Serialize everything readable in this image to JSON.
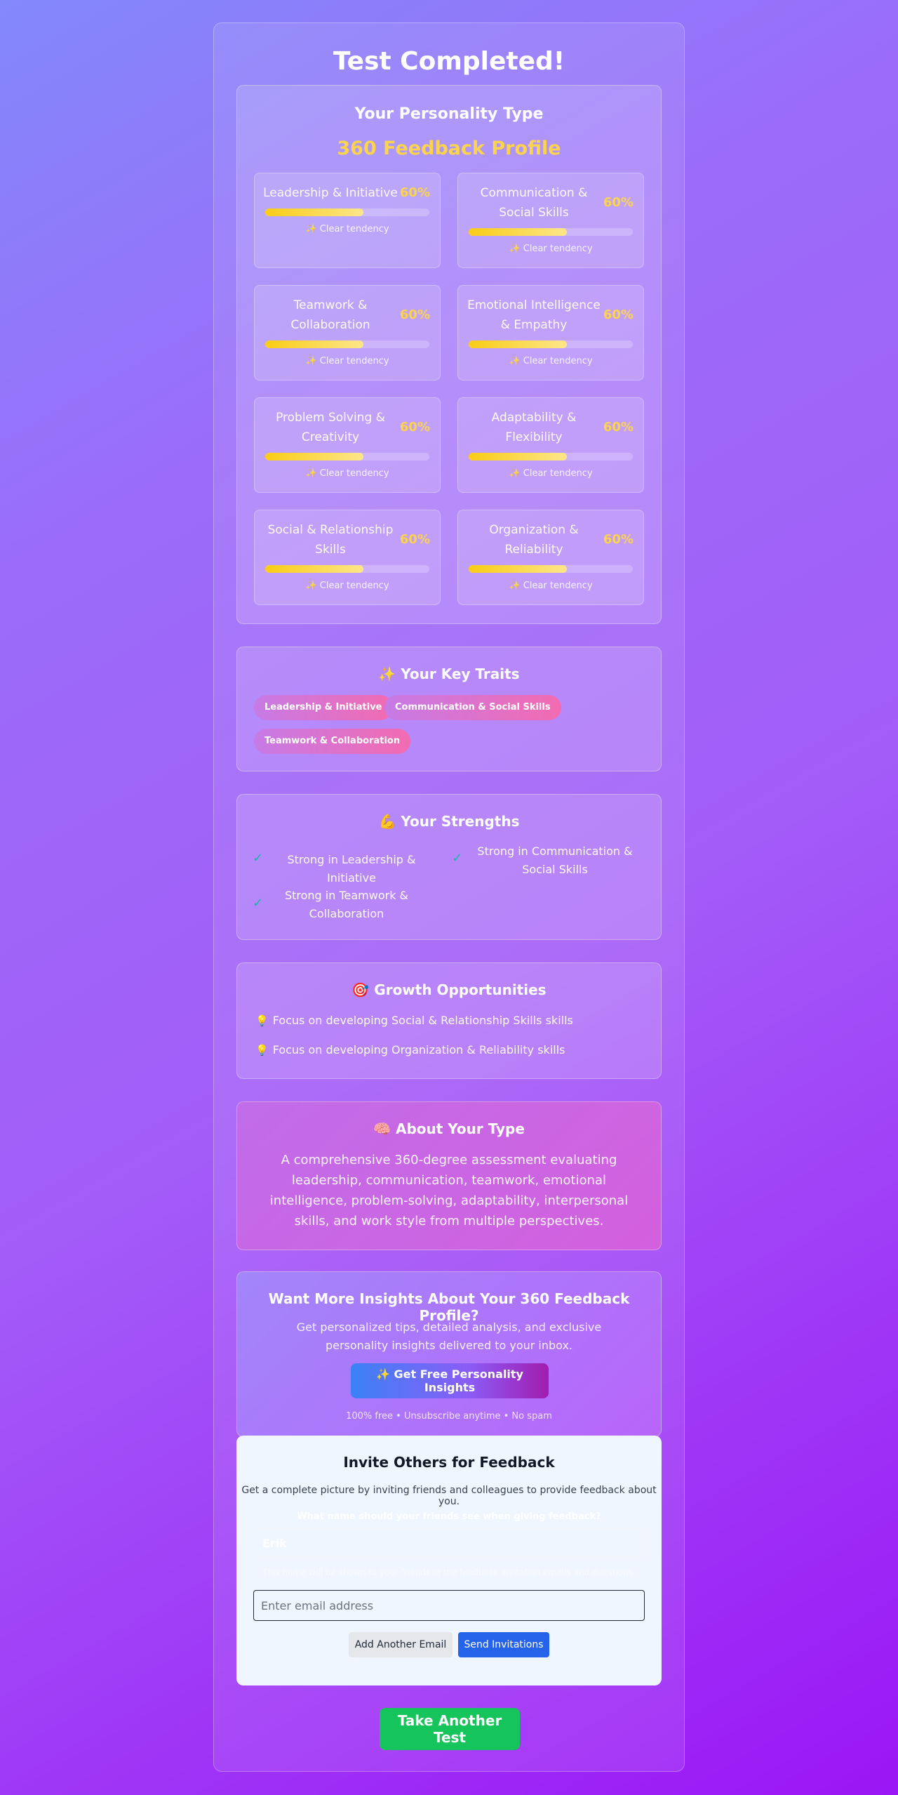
{
  "title": "Test Completed!",
  "personality": {
    "heading": "Your Personality Type",
    "type_name": "360 Feedback Profile",
    "dimensions": [
      {
        "name": "Leadership & Initiative",
        "percent_label": "60%",
        "percent": 60,
        "tendency": "✨ Clear tendency"
      },
      {
        "name": "Communication & Social Skills",
        "percent_label": "60%",
        "percent": 60,
        "tendency": "✨ Clear tendency"
      },
      {
        "name": "Teamwork & Collaboration",
        "percent_label": "60%",
        "percent": 60,
        "tendency": "✨ Clear tendency"
      },
      {
        "name": "Emotional Intelligence & Empathy",
        "percent_label": "60%",
        "percent": 60,
        "tendency": "✨ Clear tendency"
      },
      {
        "name": "Problem Solving & Creativity",
        "percent_label": "60%",
        "percent": 60,
        "tendency": "✨ Clear tendency"
      },
      {
        "name": "Adaptability & Flexibility",
        "percent_label": "60%",
        "percent": 60,
        "tendency": "✨ Clear tendency"
      },
      {
        "name": "Social & Relationship Skills",
        "percent_label": "60%",
        "percent": 60,
        "tendency": "✨ Clear tendency"
      },
      {
        "name": "Organization & Reliability",
        "percent_label": "60%",
        "percent": 60,
        "tendency": "✨ Clear tendency"
      }
    ]
  },
  "traits": {
    "heading": "✨ Your Key Traits",
    "items": [
      "Leadership & Initiative",
      "Communication & Social Skills",
      "Teamwork & Collaboration"
    ]
  },
  "strengths": {
    "heading": "💪 Your Strengths",
    "check": "✓",
    "items": [
      "Strong in Leadership & Initiative",
      "Strong in Communication & Social Skills",
      "Strong in Teamwork & Collaboration"
    ]
  },
  "growth": {
    "heading": "🎯 Growth Opportunities",
    "icon": "💡",
    "items": [
      "Focus on developing Social & Relationship Skills skills",
      "Focus on developing Organization & Reliability skills"
    ]
  },
  "about": {
    "heading": "🧠 About Your Type",
    "text": "A comprehensive 360-degree assessment evaluating leadership, communication, teamwork, emotional intelligence, problem-solving, adaptability, interpersonal skills, and work style from multiple perspectives."
  },
  "insights": {
    "heading": "Want More Insights About Your 360 Feedback Profile?",
    "subtext": "Get personalized tips, detailed analysis, and exclusive personality insights delivered to your inbox.",
    "button_label": "✨ Get Free Personality Insights",
    "note": "100% free • Unsubscribe anytime • No spam"
  },
  "invite": {
    "heading": "Invite Others for Feedback",
    "subtext": "Get a complete picture by inviting friends and colleagues to provide feedback about you.",
    "name_label": "What name should your friends see when giving feedback?",
    "name_value": "Erik",
    "name_help": "This name will be shown to your friends in the feedback invitation emails and questions.",
    "email_placeholder": "Enter email address",
    "add_label": "Add Another Email",
    "send_label": "Send Invitations"
  },
  "retake_label": "Take Another Test",
  "colors": {
    "accent_yellow": "#fcd34d",
    "check_teal": "#14b8a6",
    "send_blue": "#2563eb",
    "retake_green": "#16c45c"
  }
}
